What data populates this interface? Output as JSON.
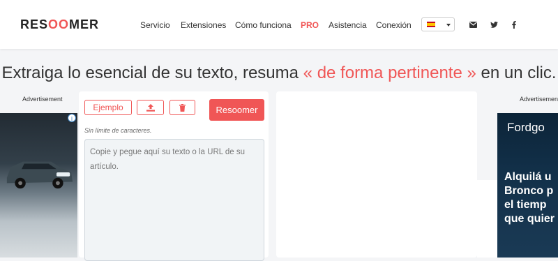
{
  "header": {
    "logo_prefix": "RES",
    "logo_accent": "OO",
    "logo_suffix": "MER",
    "nav": [
      "Servicio",
      "Extensiones",
      "Cómo funciona",
      "PRO",
      "Asistencia",
      "Conexión"
    ],
    "language_flag": "spain-flag",
    "social_icons": [
      "envelope-icon",
      "twitter-icon",
      "facebook-icon"
    ]
  },
  "headline": {
    "before": "Extraiga lo esencial de su texto, resuma ",
    "highlight": "« de forma pertinente »",
    "after": " en un clic."
  },
  "ads": {
    "label_left": "Advertisement",
    "label_right": "Advertisement",
    "info_icon": "i",
    "right_brand": "Fordgo",
    "right_lines": [
      "Alquilá u",
      "Bronco p",
      "el tiemp",
      "que quier"
    ]
  },
  "editor": {
    "example_label": "Ejemplo",
    "upload_icon": "upload-icon",
    "delete_icon": "trash-icon",
    "submit_label": "Resoomer",
    "limit_note": "Sin límite de caracteres.",
    "placeholder": "Copie y pegue aquí su texto o la URL de su artículo."
  },
  "colors": {
    "accent": "#f05656",
    "page_bg": "#f4f5f7",
    "ad_right_bg": "#123049"
  }
}
